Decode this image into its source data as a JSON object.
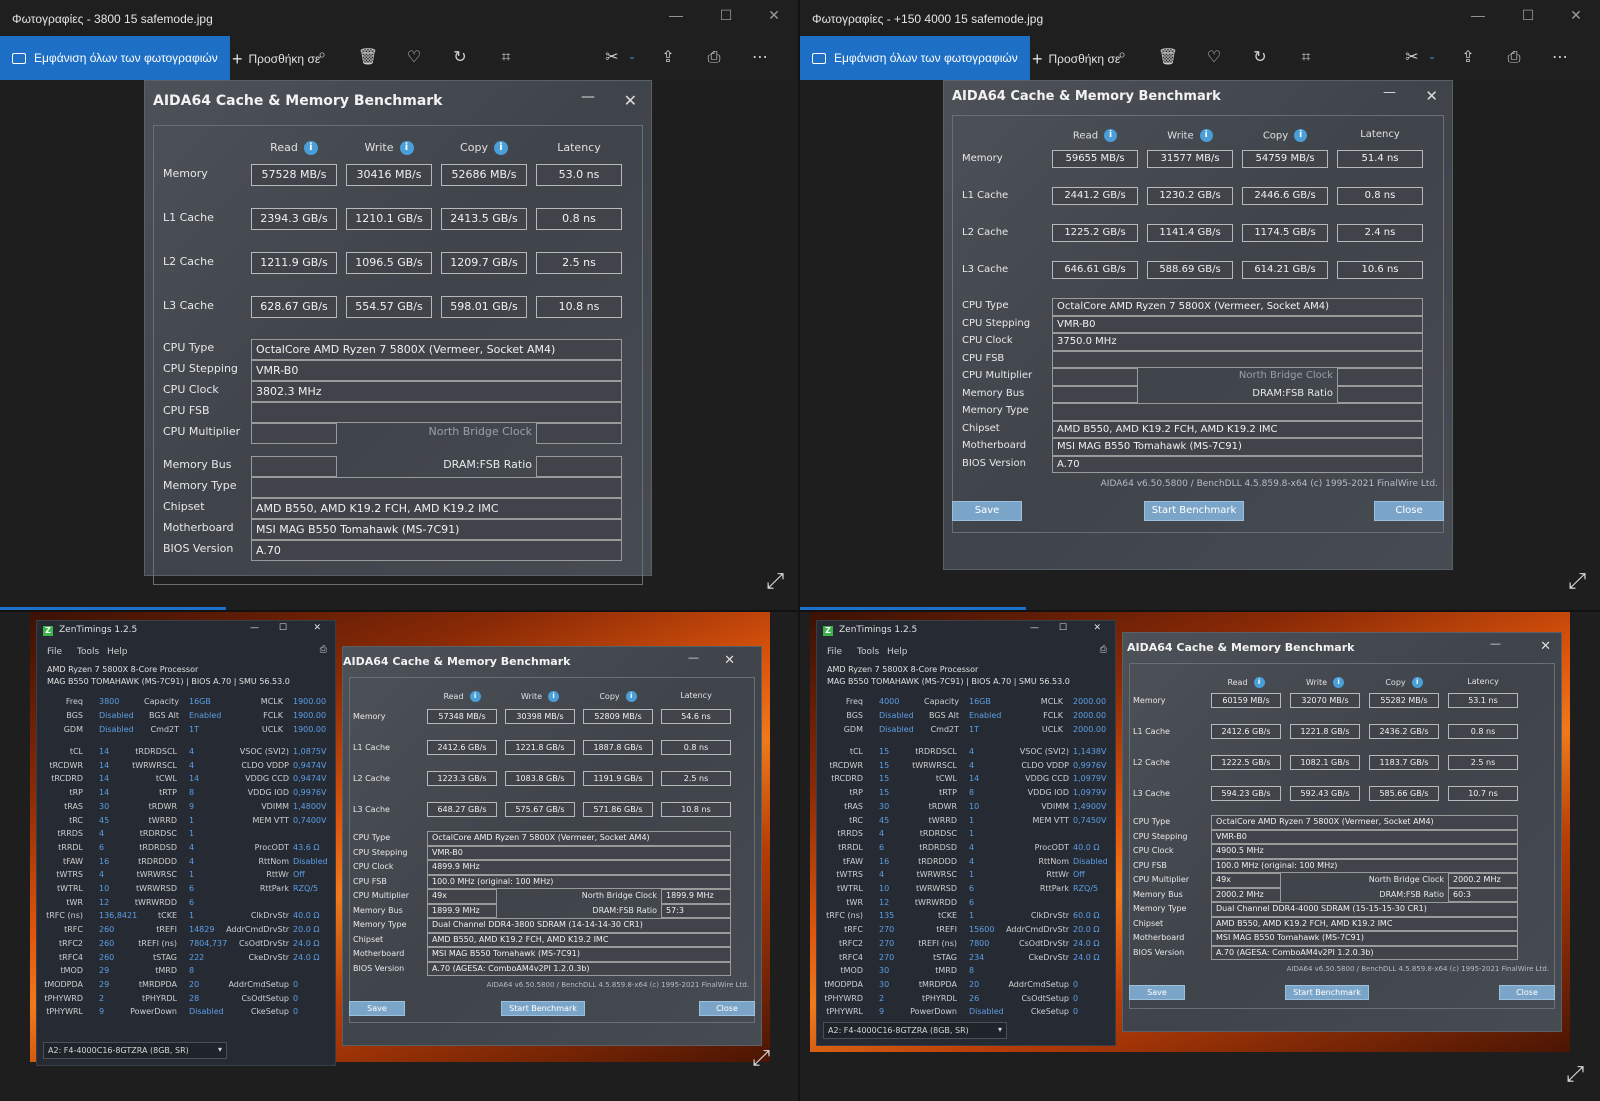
{
  "viewer": {
    "show_all": "Εμφάνιση όλων των φωτογραφιών",
    "add_to": "Προσθήκη σε"
  },
  "q1": {
    "title": "Φωτογραφίες - 3800 15 safemode.jpg",
    "aida": {
      "title": "AIDA64 Cache & Memory Benchmark",
      "cols": [
        "Read",
        "Write",
        "Copy",
        "Latency"
      ],
      "rows": [
        {
          "label": "Memory",
          "values": [
            "57528 MB/s",
            "30416 MB/s",
            "52686 MB/s",
            "53.0 ns"
          ]
        },
        {
          "label": "L1 Cache",
          "values": [
            "2394.3 GB/s",
            "1210.1 GB/s",
            "2413.5 GB/s",
            "0.8 ns"
          ]
        },
        {
          "label": "L2 Cache",
          "values": [
            "1211.9 GB/s",
            "1096.5 GB/s",
            "1209.7 GB/s",
            "2.5 ns"
          ]
        },
        {
          "label": "L3 Cache",
          "values": [
            "628.67 GB/s",
            "554.57 GB/s",
            "598.01 GB/s",
            "10.8 ns"
          ]
        }
      ],
      "cpu_type_label": "CPU Type",
      "cpu_type": "OctalCore AMD Ryzen 7 5800X (Vermeer, Socket AM4)",
      "cpu_stepping_label": "CPU Stepping",
      "cpu_stepping": "VMR-B0",
      "cpu_clock_label": "CPU Clock",
      "cpu_clock": "3802.3 MHz",
      "cpu_fsb_label": "CPU FSB",
      "cpu_fsb": "",
      "cpu_mult_label": "CPU Multiplier",
      "cpu_mult": "",
      "nb_clock_label": "North Bridge Clock",
      "nb_clock": "",
      "mem_bus_label": "Memory Bus",
      "mem_bus": "",
      "dram_ratio_label": "DRAM:FSB Ratio",
      "dram_ratio": "",
      "mem_type_label": "Memory Type",
      "mem_type": "",
      "chipset_label": "Chipset",
      "chipset": "AMD B550, AMD K19.2 FCH, AMD K19.2 IMC",
      "mobo_label": "Motherboard",
      "mobo": "MSI MAG B550 Tomahawk (MS-7C91)",
      "bios_label": "BIOS Version",
      "bios": "A.70"
    }
  },
  "q2": {
    "title": "Φωτογραφίες - +150 4000 15 safemode.jpg",
    "aida": {
      "title": "AIDA64 Cache & Memory Benchmark",
      "cols": [
        "Read",
        "Write",
        "Copy",
        "Latency"
      ],
      "rows": [
        {
          "label": "Memory",
          "values": [
            "59655 MB/s",
            "31577 MB/s",
            "54759 MB/s",
            "51.4 ns"
          ]
        },
        {
          "label": "L1 Cache",
          "values": [
            "2441.2 GB/s",
            "1230.2 GB/s",
            "2446.6 GB/s",
            "0.8 ns"
          ]
        },
        {
          "label": "L2 Cache",
          "values": [
            "1225.2 GB/s",
            "1141.4 GB/s",
            "1174.5 GB/s",
            "2.4 ns"
          ]
        },
        {
          "label": "L3 Cache",
          "values": [
            "646.61 GB/s",
            "588.69 GB/s",
            "614.21 GB/s",
            "10.6 ns"
          ]
        }
      ],
      "cpu_type_label": "CPU Type",
      "cpu_type": "OctalCore AMD Ryzen 7 5800X (Vermeer, Socket AM4)",
      "cpu_stepping_label": "CPU Stepping",
      "cpu_stepping": "VMR-B0",
      "cpu_clock_label": "CPU Clock",
      "cpu_clock": "3750.0 MHz",
      "cpu_fsb_label": "CPU FSB",
      "cpu_fsb": "",
      "cpu_mult_label": "CPU Multiplier",
      "cpu_mult": "",
      "nb_clock_label": "North Bridge Clock",
      "nb_clock": "",
      "mem_bus_label": "Memory Bus",
      "mem_bus": "",
      "dram_ratio_label": "DRAM:FSB Ratio",
      "dram_ratio": "",
      "mem_type_label": "Memory Type",
      "mem_type": "",
      "chipset_label": "Chipset",
      "chipset": "AMD B550, AMD K19.2 FCH, AMD K19.2 IMC",
      "mobo_label": "Motherboard",
      "mobo": "MSI MAG B550 Tomahawk (MS-7C91)",
      "bios_label": "BIOS Version",
      "bios": "A.70",
      "footer": "AIDA64 v6.50.5800 / BenchDLL 4.5.859.8-x64  (c) 1995-2021 FinalWire Ltd.",
      "save": "Save",
      "start": "Start Benchmark",
      "close": "Close"
    }
  },
  "q3": {
    "zen": {
      "title": "ZenTimings 1.2.5",
      "menu": [
        "File",
        "Tools",
        "Help"
      ],
      "cpu": "AMD Ryzen 7 5800X 8-Core Processor",
      "board": "MAG B550 TOMAHAWK (MS-7C91) | BIOS A.70 | SMU 56.53.0",
      "freq": [
        [
          "Freq",
          "3800"
        ],
        [
          "BGS",
          "Disabled"
        ],
        [
          "GDM",
          "Disabled"
        ]
      ],
      "cap": [
        [
          "Capacity",
          "16GB"
        ],
        [
          "BGS Alt",
          "Enabled"
        ],
        [
          "Cmd2T",
          "1T"
        ]
      ],
      "clk": [
        [
          "MCLK",
          "1900.00"
        ],
        [
          "FCLK",
          "1900.00"
        ],
        [
          "UCLK",
          "1900.00"
        ]
      ],
      "c1": [
        [
          "tCL",
          "14"
        ],
        [
          "tRCDWR",
          "14"
        ],
        [
          "tRCDRD",
          "14"
        ],
        [
          "tRP",
          "14"
        ],
        [
          "tRAS",
          "30"
        ],
        [
          "tRC",
          "45"
        ],
        [
          "tRRDS",
          "4"
        ],
        [
          "tRRDL",
          "6"
        ],
        [
          "tFAW",
          "16"
        ],
        [
          "tWTRS",
          "4"
        ],
        [
          "tWTRL",
          "10"
        ],
        [
          "tWR",
          "12"
        ],
        [
          "tRFC (ns)",
          "136,8421"
        ],
        [
          "tRFC",
          "260"
        ],
        [
          "tRFC2",
          "260"
        ],
        [
          "tRFC4",
          "260"
        ],
        [
          "tMOD",
          "29"
        ],
        [
          "tMODPDA",
          "29"
        ],
        [
          "tPHYWRD",
          "2"
        ],
        [
          "tPHYWRL",
          "9"
        ]
      ],
      "c2": [
        [
          "tRDRDSCL",
          "4"
        ],
        [
          "tWRWRSCL",
          "4"
        ],
        [
          "tCWL",
          "14"
        ],
        [
          "tRTP",
          "8"
        ],
        [
          "tRDWR",
          "9"
        ],
        [
          "tWRRD",
          "1"
        ],
        [
          "tRDRDSC",
          "1"
        ],
        [
          "tRDRDSD",
          "4"
        ],
        [
          "tRDRDDD",
          "4"
        ],
        [
          "tWRWRSC",
          "1"
        ],
        [
          "tWRWRSD",
          "6"
        ],
        [
          "tWRWRDD",
          "6"
        ],
        [
          "tCKE",
          "1"
        ],
        [
          "tREFI",
          "14829"
        ],
        [
          "tREFI (ns)",
          "7804,737"
        ],
        [
          "tSTAG",
          "222"
        ],
        [
          "tMRD",
          "8"
        ],
        [
          "tMRDPDA",
          "20"
        ],
        [
          "tPHYRDL",
          "28"
        ],
        [
          "PowerDown",
          "Disabled"
        ]
      ],
      "c3": [
        [
          "VSOC (SVI2)",
          "1,0875V"
        ],
        [
          "CLDO VDDP",
          "0,9474V"
        ],
        [
          "VDDG CCD",
          "0,9474V"
        ],
        [
          "VDDG IOD",
          "0,9976V"
        ],
        [
          "VDIMM",
          "1,4800V"
        ],
        [
          "MEM VTT",
          "0,7400V"
        ],
        [
          "",
          ""
        ],
        [
          "ProcODT",
          "43.6 Ω"
        ],
        [
          "RttNom",
          "Disabled"
        ],
        [
          "RttWr",
          "Off"
        ],
        [
          "RttPark",
          "RZQ/5"
        ],
        [
          "",
          ""
        ],
        [
          "ClkDrvStr",
          "40.0 Ω"
        ],
        [
          "AddrCmdDrvStr",
          "20.0 Ω"
        ],
        [
          "CsOdtDrvStr",
          "24.0 Ω"
        ],
        [
          "CkeDrvStr",
          "24.0 Ω"
        ],
        [
          "",
          ""
        ],
        [
          "AddrCmdSetup",
          "0"
        ],
        [
          "CsOdtSetup",
          "0"
        ],
        [
          "CkeSetup",
          "0"
        ]
      ],
      "dimm": "A2: F4-4000C16-8GTZRA (8GB, SR)"
    },
    "aida": {
      "title": "AIDA64 Cache & Memory Benchmark",
      "cols": [
        "Read",
        "Write",
        "Copy",
        "Latency"
      ],
      "rows": [
        {
          "label": "Memory",
          "values": [
            "57348 MB/s",
            "30398 MB/s",
            "52809 MB/s",
            "54.6 ns"
          ]
        },
        {
          "label": "L1 Cache",
          "values": [
            "2412.6 GB/s",
            "1221.8 GB/s",
            "1887.8 GB/s",
            "0.8 ns"
          ]
        },
        {
          "label": "L2 Cache",
          "values": [
            "1223.3 GB/s",
            "1083.8 GB/s",
            "1191.9 GB/s",
            "2.5 ns"
          ]
        },
        {
          "label": "L3 Cache",
          "values": [
            "648.27 GB/s",
            "575.67 GB/s",
            "571.86 GB/s",
            "10.8 ns"
          ]
        }
      ],
      "cpu_type_label": "CPU Type",
      "cpu_type": "OctalCore AMD Ryzen 7 5800X (Vermeer, Socket AM4)",
      "cpu_stepping_label": "CPU Stepping",
      "cpu_stepping": "VMR-B0",
      "cpu_clock_label": "CPU Clock",
      "cpu_clock": "4899.9 MHz",
      "cpu_fsb_label": "CPU FSB",
      "cpu_fsb": "100.0 MHz  (original: 100 MHz)",
      "cpu_mult_label": "CPU Multiplier",
      "cpu_mult": "49x",
      "nb_clock_label": "North Bridge Clock",
      "nb_clock": "1899.9 MHz",
      "mem_bus_label": "Memory Bus",
      "mem_bus": "1899.9 MHz",
      "dram_ratio_label": "DRAM:FSB Ratio",
      "dram_ratio": "57:3",
      "mem_type_label": "Memory Type",
      "mem_type": "Dual Channel DDR4-3800 SDRAM  (14-14-14-30 CR1)",
      "chipset_label": "Chipset",
      "chipset": "AMD B550, AMD K19.2 FCH, AMD K19.2 IMC",
      "mobo_label": "Motherboard",
      "mobo": "MSI MAG B550 Tomahawk (MS-7C91)",
      "bios_label": "BIOS Version",
      "bios": "A.70  (AGESA: ComboAM4v2PI 1.2.0.3b)",
      "footer": "AIDA64 v6.50.5800 / BenchDLL 4.5.859.8-x64  (c) 1995-2021 FinalWire Ltd.",
      "save": "Save",
      "start": "Start Benchmark",
      "close": "Close"
    }
  },
  "q4": {
    "zen": {
      "title": "ZenTimings 1.2.5",
      "menu": [
        "File",
        "Tools",
        "Help"
      ],
      "cpu": "AMD Ryzen 7 5800X 8-Core Processor",
      "board": "MAG B550 TOMAHAWK (MS-7C91) | BIOS A.70 | SMU 56.53.0",
      "freq": [
        [
          "Freq",
          "4000"
        ],
        [
          "BGS",
          "Disabled"
        ],
        [
          "GDM",
          "Disabled"
        ]
      ],
      "cap": [
        [
          "Capacity",
          "16GB"
        ],
        [
          "BGS Alt",
          "Enabled"
        ],
        [
          "Cmd2T",
          "1T"
        ]
      ],
      "clk": [
        [
          "MCLK",
          "2000.00"
        ],
        [
          "FCLK",
          "2000.00"
        ],
        [
          "UCLK",
          "2000.00"
        ]
      ],
      "c1": [
        [
          "tCL",
          "15"
        ],
        [
          "tRCDWR",
          "15"
        ],
        [
          "tRCDRD",
          "15"
        ],
        [
          "tRP",
          "15"
        ],
        [
          "tRAS",
          "30"
        ],
        [
          "tRC",
          "45"
        ],
        [
          "tRRDS",
          "4"
        ],
        [
          "tRRDL",
          "6"
        ],
        [
          "tFAW",
          "16"
        ],
        [
          "tWTRS",
          "4"
        ],
        [
          "tWTRL",
          "10"
        ],
        [
          "tWR",
          "12"
        ],
        [
          "tRFC (ns)",
          "135"
        ],
        [
          "tRFC",
          "270"
        ],
        [
          "tRFC2",
          "270"
        ],
        [
          "tRFC4",
          "270"
        ],
        [
          "tMOD",
          "30"
        ],
        [
          "tMODPDA",
          "30"
        ],
        [
          "tPHYWRD",
          "2"
        ],
        [
          "tPHYWRL",
          "9"
        ]
      ],
      "c2": [
        [
          "tRDRDSCL",
          "4"
        ],
        [
          "tWRWRSCL",
          "4"
        ],
        [
          "tCWL",
          "14"
        ],
        [
          "tRTP",
          "8"
        ],
        [
          "tRDWR",
          "10"
        ],
        [
          "tWRRD",
          "1"
        ],
        [
          "tRDRDSC",
          "1"
        ],
        [
          "tRDRDSD",
          "4"
        ],
        [
          "tRDRDDD",
          "4"
        ],
        [
          "tWRWRSC",
          "1"
        ],
        [
          "tWRWRSD",
          "6"
        ],
        [
          "tWRWRDD",
          "6"
        ],
        [
          "tCKE",
          "1"
        ],
        [
          "tREFI",
          "15600"
        ],
        [
          "tREFI (ns)",
          "7800"
        ],
        [
          "tSTAG",
          "234"
        ],
        [
          "tMRD",
          "8"
        ],
        [
          "tMRDPDA",
          "20"
        ],
        [
          "tPHYRDL",
          "26"
        ],
        [
          "PowerDown",
          "Disabled"
        ]
      ],
      "c3": [
        [
          "VSOC (SVI2)",
          "1,1438V"
        ],
        [
          "CLDO VDDP",
          "0,9976V"
        ],
        [
          "VDDG CCD",
          "1,0979V"
        ],
        [
          "VDDG IOD",
          "1,0979V"
        ],
        [
          "VDIMM",
          "1,4900V"
        ],
        [
          "MEM VTT",
          "0,7450V"
        ],
        [
          "",
          ""
        ],
        [
          "ProcODT",
          "40.0 Ω"
        ],
        [
          "RttNom",
          "Disabled"
        ],
        [
          "RttWr",
          "Off"
        ],
        [
          "RttPark",
          "RZQ/5"
        ],
        [
          "",
          ""
        ],
        [
          "ClkDrvStr",
          "60.0 Ω"
        ],
        [
          "AddrCmdDrvStr",
          "20.0 Ω"
        ],
        [
          "CsOdtDrvStr",
          "24.0 Ω"
        ],
        [
          "CkeDrvStr",
          "24.0 Ω"
        ],
        [
          "",
          ""
        ],
        [
          "AddrCmdSetup",
          "0"
        ],
        [
          "CsOdtSetup",
          "0"
        ],
        [
          "CkeSetup",
          "0"
        ]
      ],
      "dimm": "A2: F4-4000C16-8GTZRA (8GB, SR)"
    },
    "aida": {
      "title": "AIDA64 Cache & Memory Benchmark",
      "cols": [
        "Read",
        "Write",
        "Copy",
        "Latency"
      ],
      "rows": [
        {
          "label": "Memory",
          "values": [
            "60159 MB/s",
            "32070 MB/s",
            "55282 MB/s",
            "53.1 ns"
          ]
        },
        {
          "label": "L1 Cache",
          "values": [
            "2412.6 GB/s",
            "1221.8 GB/s",
            "2436.2 GB/s",
            "0.8 ns"
          ]
        },
        {
          "label": "L2 Cache",
          "values": [
            "1222.5 GB/s",
            "1082.1 GB/s",
            "1183.7 GB/s",
            "2.5 ns"
          ]
        },
        {
          "label": "L3 Cache",
          "values": [
            "594.23 GB/s",
            "592.43 GB/s",
            "585.66 GB/s",
            "10.7 ns"
          ]
        }
      ],
      "cpu_type_label": "CPU Type",
      "cpu_type": "OctalCore AMD Ryzen 7 5800X (Vermeer, Socket AM4)",
      "cpu_stepping_label": "CPU Stepping",
      "cpu_stepping": "VMR-B0",
      "cpu_clock_label": "CPU Clock",
      "cpu_clock": "4900.5 MHz",
      "cpu_fsb_label": "CPU FSB",
      "cpu_fsb": "100.0 MHz  (original: 100 MHz)",
      "cpu_mult_label": "CPU Multiplier",
      "cpu_mult": "49x",
      "nb_clock_label": "North Bridge Clock",
      "nb_clock": "2000.2 MHz",
      "mem_bus_label": "Memory Bus",
      "mem_bus": "2000.2 MHz",
      "dram_ratio_label": "DRAM:FSB Ratio",
      "dram_ratio": "60:3",
      "mem_type_label": "Memory Type",
      "mem_type": "Dual Channel DDR4-4000 SDRAM  (15-15-15-30 CR1)",
      "chipset_label": "Chipset",
      "chipset": "AMD B550, AMD K19.2 FCH, AMD K19.2 IMC",
      "mobo_label": "Motherboard",
      "mobo": "MSI MAG B550 Tomahawk (MS-7C91)",
      "bios_label": "BIOS Version",
      "bios": "A.70  (AGESA: ComboAM4v2PI 1.2.0.3b)",
      "footer": "AIDA64 v6.50.5800 / BenchDLL 4.5.859.8-x64  (c) 1995-2021 FinalWire Ltd.",
      "save": "Save",
      "start": "Start Benchmark",
      "close": "Close"
    }
  }
}
